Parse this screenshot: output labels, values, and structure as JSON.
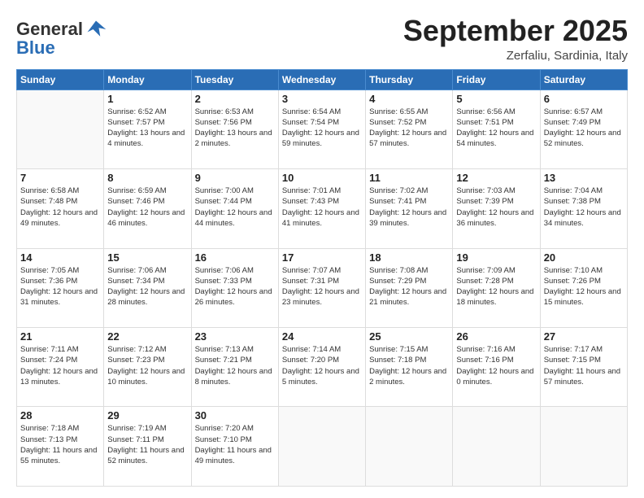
{
  "header": {
    "logo_line1": "General",
    "logo_line2": "Blue",
    "month": "September 2025",
    "location": "Zerfaliu, Sardinia, Italy"
  },
  "days_of_week": [
    "Sunday",
    "Monday",
    "Tuesday",
    "Wednesday",
    "Thursday",
    "Friday",
    "Saturday"
  ],
  "weeks": [
    [
      {
        "day": "",
        "sunrise": "",
        "sunset": "",
        "daylight": ""
      },
      {
        "day": "1",
        "sunrise": "Sunrise: 6:52 AM",
        "sunset": "Sunset: 7:57 PM",
        "daylight": "Daylight: 13 hours and 4 minutes."
      },
      {
        "day": "2",
        "sunrise": "Sunrise: 6:53 AM",
        "sunset": "Sunset: 7:56 PM",
        "daylight": "Daylight: 13 hours and 2 minutes."
      },
      {
        "day": "3",
        "sunrise": "Sunrise: 6:54 AM",
        "sunset": "Sunset: 7:54 PM",
        "daylight": "Daylight: 12 hours and 59 minutes."
      },
      {
        "day": "4",
        "sunrise": "Sunrise: 6:55 AM",
        "sunset": "Sunset: 7:52 PM",
        "daylight": "Daylight: 12 hours and 57 minutes."
      },
      {
        "day": "5",
        "sunrise": "Sunrise: 6:56 AM",
        "sunset": "Sunset: 7:51 PM",
        "daylight": "Daylight: 12 hours and 54 minutes."
      },
      {
        "day": "6",
        "sunrise": "Sunrise: 6:57 AM",
        "sunset": "Sunset: 7:49 PM",
        "daylight": "Daylight: 12 hours and 52 minutes."
      }
    ],
    [
      {
        "day": "7",
        "sunrise": "Sunrise: 6:58 AM",
        "sunset": "Sunset: 7:48 PM",
        "daylight": "Daylight: 12 hours and 49 minutes."
      },
      {
        "day": "8",
        "sunrise": "Sunrise: 6:59 AM",
        "sunset": "Sunset: 7:46 PM",
        "daylight": "Daylight: 12 hours and 46 minutes."
      },
      {
        "day": "9",
        "sunrise": "Sunrise: 7:00 AM",
        "sunset": "Sunset: 7:44 PM",
        "daylight": "Daylight: 12 hours and 44 minutes."
      },
      {
        "day": "10",
        "sunrise": "Sunrise: 7:01 AM",
        "sunset": "Sunset: 7:43 PM",
        "daylight": "Daylight: 12 hours and 41 minutes."
      },
      {
        "day": "11",
        "sunrise": "Sunrise: 7:02 AM",
        "sunset": "Sunset: 7:41 PM",
        "daylight": "Daylight: 12 hours and 39 minutes."
      },
      {
        "day": "12",
        "sunrise": "Sunrise: 7:03 AM",
        "sunset": "Sunset: 7:39 PM",
        "daylight": "Daylight: 12 hours and 36 minutes."
      },
      {
        "day": "13",
        "sunrise": "Sunrise: 7:04 AM",
        "sunset": "Sunset: 7:38 PM",
        "daylight": "Daylight: 12 hours and 34 minutes."
      }
    ],
    [
      {
        "day": "14",
        "sunrise": "Sunrise: 7:05 AM",
        "sunset": "Sunset: 7:36 PM",
        "daylight": "Daylight: 12 hours and 31 minutes."
      },
      {
        "day": "15",
        "sunrise": "Sunrise: 7:06 AM",
        "sunset": "Sunset: 7:34 PM",
        "daylight": "Daylight: 12 hours and 28 minutes."
      },
      {
        "day": "16",
        "sunrise": "Sunrise: 7:06 AM",
        "sunset": "Sunset: 7:33 PM",
        "daylight": "Daylight: 12 hours and 26 minutes."
      },
      {
        "day": "17",
        "sunrise": "Sunrise: 7:07 AM",
        "sunset": "Sunset: 7:31 PM",
        "daylight": "Daylight: 12 hours and 23 minutes."
      },
      {
        "day": "18",
        "sunrise": "Sunrise: 7:08 AM",
        "sunset": "Sunset: 7:29 PM",
        "daylight": "Daylight: 12 hours and 21 minutes."
      },
      {
        "day": "19",
        "sunrise": "Sunrise: 7:09 AM",
        "sunset": "Sunset: 7:28 PM",
        "daylight": "Daylight: 12 hours and 18 minutes."
      },
      {
        "day": "20",
        "sunrise": "Sunrise: 7:10 AM",
        "sunset": "Sunset: 7:26 PM",
        "daylight": "Daylight: 12 hours and 15 minutes."
      }
    ],
    [
      {
        "day": "21",
        "sunrise": "Sunrise: 7:11 AM",
        "sunset": "Sunset: 7:24 PM",
        "daylight": "Daylight: 12 hours and 13 minutes."
      },
      {
        "day": "22",
        "sunrise": "Sunrise: 7:12 AM",
        "sunset": "Sunset: 7:23 PM",
        "daylight": "Daylight: 12 hours and 10 minutes."
      },
      {
        "day": "23",
        "sunrise": "Sunrise: 7:13 AM",
        "sunset": "Sunset: 7:21 PM",
        "daylight": "Daylight: 12 hours and 8 minutes."
      },
      {
        "day": "24",
        "sunrise": "Sunrise: 7:14 AM",
        "sunset": "Sunset: 7:20 PM",
        "daylight": "Daylight: 12 hours and 5 minutes."
      },
      {
        "day": "25",
        "sunrise": "Sunrise: 7:15 AM",
        "sunset": "Sunset: 7:18 PM",
        "daylight": "Daylight: 12 hours and 2 minutes."
      },
      {
        "day": "26",
        "sunrise": "Sunrise: 7:16 AM",
        "sunset": "Sunset: 7:16 PM",
        "daylight": "Daylight: 12 hours and 0 minutes."
      },
      {
        "day": "27",
        "sunrise": "Sunrise: 7:17 AM",
        "sunset": "Sunset: 7:15 PM",
        "daylight": "Daylight: 11 hours and 57 minutes."
      }
    ],
    [
      {
        "day": "28",
        "sunrise": "Sunrise: 7:18 AM",
        "sunset": "Sunset: 7:13 PM",
        "daylight": "Daylight: 11 hours and 55 minutes."
      },
      {
        "day": "29",
        "sunrise": "Sunrise: 7:19 AM",
        "sunset": "Sunset: 7:11 PM",
        "daylight": "Daylight: 11 hours and 52 minutes."
      },
      {
        "day": "30",
        "sunrise": "Sunrise: 7:20 AM",
        "sunset": "Sunset: 7:10 PM",
        "daylight": "Daylight: 11 hours and 49 minutes."
      },
      {
        "day": "",
        "sunrise": "",
        "sunset": "",
        "daylight": ""
      },
      {
        "day": "",
        "sunrise": "",
        "sunset": "",
        "daylight": ""
      },
      {
        "day": "",
        "sunrise": "",
        "sunset": "",
        "daylight": ""
      },
      {
        "day": "",
        "sunrise": "",
        "sunset": "",
        "daylight": ""
      }
    ]
  ]
}
